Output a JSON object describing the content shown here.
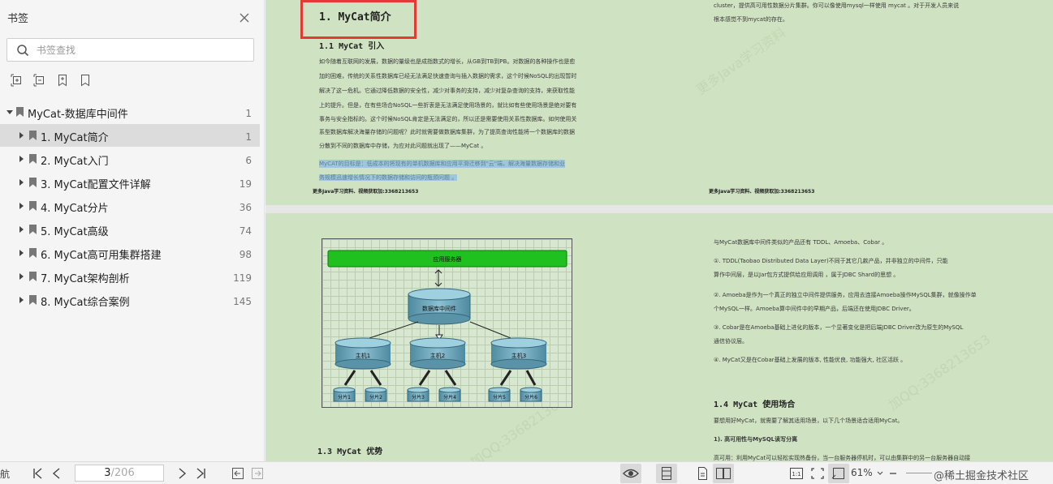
{
  "sidebar": {
    "title": "书签",
    "search_placeholder": "书签查找",
    "tree": [
      {
        "label": "MyCat-数据库中间件",
        "page": "1",
        "level": 0,
        "expanded": true
      },
      {
        "label": "1. MyCat简介",
        "page": "1",
        "level": 1,
        "selected": true
      },
      {
        "label": "2. MyCat入门",
        "page": "6",
        "level": 1
      },
      {
        "label": "3. MyCat配置文件详解",
        "page": "19",
        "level": 1
      },
      {
        "label": "4. MyCat分片",
        "page": "36",
        "level": 1
      },
      {
        "label": "5. MyCat高级",
        "page": "74",
        "level": 1
      },
      {
        "label": "6. MyCat高可用集群搭建",
        "page": "98",
        "level": 1
      },
      {
        "label": "7. MyCat架构剖析",
        "page": "119",
        "level": 1
      },
      {
        "label": "8. MyCat综合案例",
        "page": "145",
        "level": 1
      }
    ]
  },
  "doc": {
    "page1_left": {
      "heading": "1. MyCat简介",
      "sub": "1.1 MyCat 引入",
      "lines": [
        "如今随着互联网的发展，数据的量级也是成指数式的增长，从GB到TB到PB。对数据的各种操作也是愈",
        "加的困难，传统的关系性数据库已经无法满足快速查询与插入数据的需求，这个时候NoSQL的出现暂时",
        "解决了这一危机。它通过降低数据的安全性，减少对事务的支持，减少对复杂查询的支持，来获取性能",
        "上的提升。但是，在有些场合NoSQL一些折衷是无法满足使用场景的，就比如有些使用场景是绝对要有",
        "事务与安全指标的。这个时候NoSQL肯定是无法满足的，所以还是需要使用关系性数据库。如何使用关",
        "系型数据库解决海量存储的问题呢？此时就需要做数据库集群，为了提高查询性能将一个数据库的数据",
        "分散到不同的数据库中存储，为应对此问题就出现了——MyCat 。"
      ],
      "goal1": "MyCAT的目标是：低成本的将现有的单机数据库和应用平滑迁移到\"云\"端，解决海量数据存储和业",
      "goal2": "务规模迅速增长情况下的数据存储和访问的瓶颈问题 。",
      "footer": "更多Java学习资料、视频获取加:3368213653"
    },
    "page1_right": {
      "lines": [
        "cluster，提供高可用性数据分片集群。你可以像使用mysql一样使用 mycat 。对于开发人员来说",
        "根本感觉不到mycat的存在。"
      ],
      "footer": "更多Java学习资料、视频获取加:3368213653"
    },
    "page2_left": {
      "diagram": {
        "app_server": "应用服务器",
        "middleware": "数据库中间件",
        "hosts": [
          "主机1",
          "主机2",
          "主机3"
        ],
        "shards": [
          "分片1",
          "分片2",
          "分片3",
          "分片4",
          "分片5",
          "分片6"
        ]
      },
      "sub": "1.3 MyCat 优势"
    },
    "page2_right": {
      "p1": "与MyCat数据库中间件类似的产品还有 TDDL、Amoeba、Cobar 。",
      "p2a": "①. TDDL(Taobao Distributed Data Layer)不同于其它几款产品，并非独立的中间件，只能",
      "p2b": "算作中间层，是以Jar包方式提供给应用调用 ，属于JDBC Shard的思想 。",
      "p3a": "②. Amoeba是作为一个真正的独立中间件提供服务，应用去连接Amoeba操作MySQL集群，就像操作单",
      "p3b": "个MySQL一样。Amoeba算中间件中的早期产品，后端还在使用JDBC Driver。",
      "p4a": "③. Cobar是在Amoeba基础上进化的版本，一个显著变化是把后端JDBC Driver改为原生的MySQL",
      "p4b": "通信协议层。",
      "p5": "④. MyCat又是在Cobar基础上发展的版本, 性能优良, 功能强大, 社区活跃 。",
      "sub": "1.4 MyCat 使用场合",
      "p6": "要想用好MyCat，就需要了解其适用场景，以下几个场景适合适用MyCat。",
      "p7": "1). 高可用性与MySQL读写分离",
      "p8": "高可用：利用MyCat可以轻松实现热备份，当一台服务器停机时，可以由集群中的另一台服务器自动接"
    },
    "watermarks": [
      "更多Java学习资料",
      "加QQ:3368213653",
      "加QQ:3368213653"
    ]
  },
  "bottombar": {
    "nav_label": "航",
    "current_page": "3",
    "total_pages": "/206",
    "zoom": "61%",
    "brand": "@稀土掘金技术社区"
  },
  "colors": {
    "page_bg": "#cfe2c1",
    "highlight": "#9fc6df",
    "red_box": "#e53935",
    "app_server_green": "#22bb22"
  }
}
